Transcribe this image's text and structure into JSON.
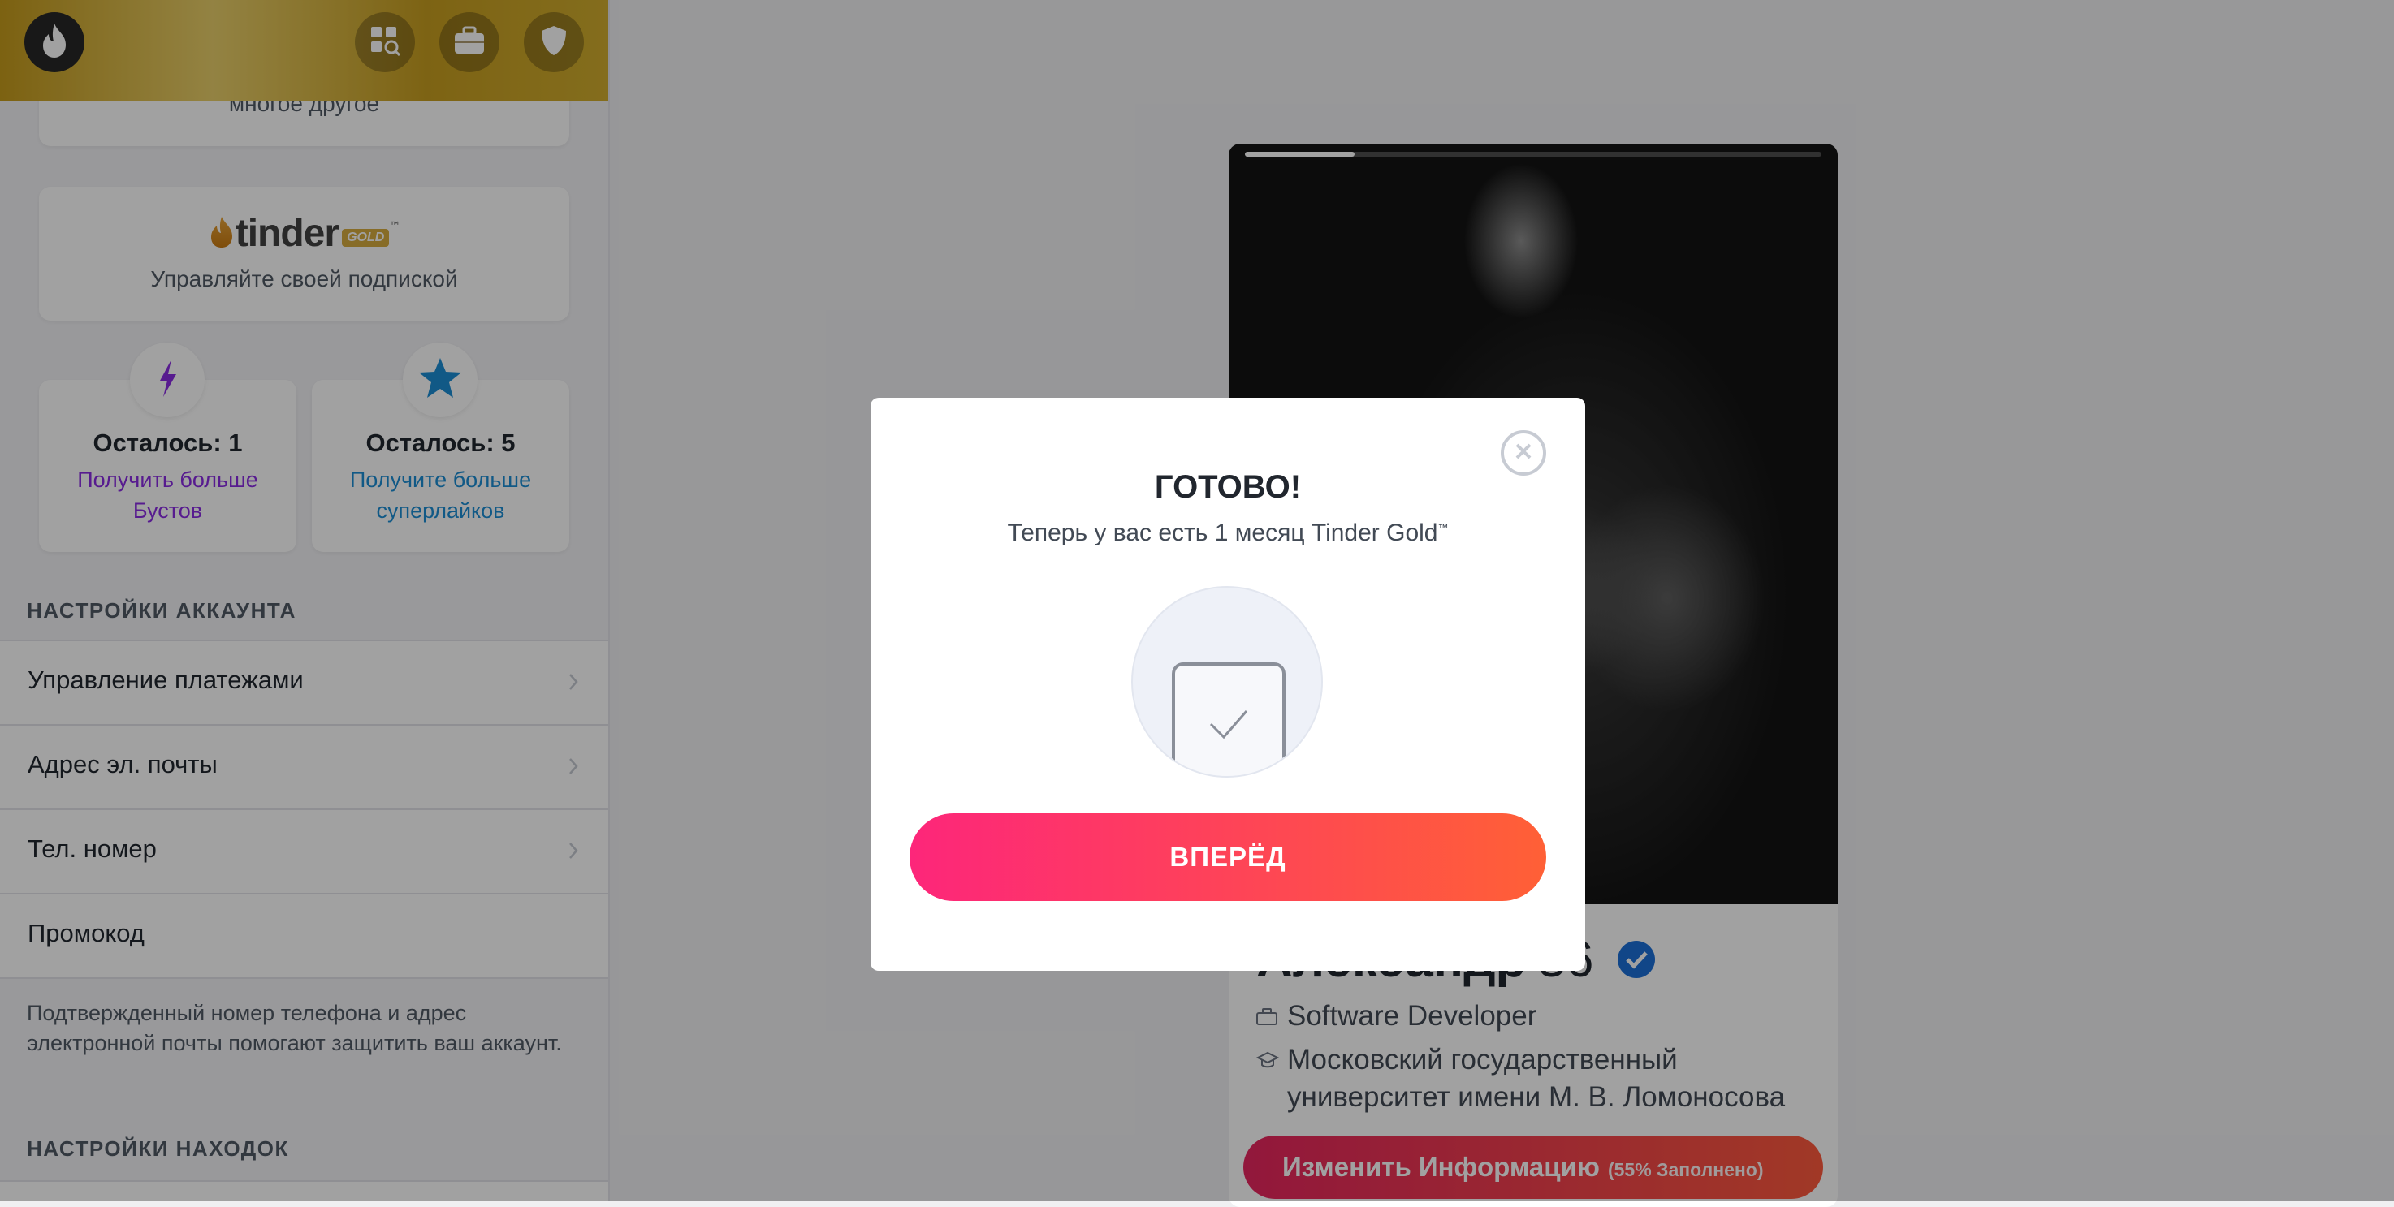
{
  "sidebar": {
    "top_card_text": "многое другое",
    "gold_card": {
      "logo_word": "tinder",
      "logo_badge": "GOLD",
      "logo_tm": "™",
      "manage_text": "Управляйте своей подпиской"
    },
    "boosts": {
      "remaining": "Осталось: 1",
      "get_more": "Получить больше Бустов",
      "color": "#8a2be2"
    },
    "super_likes": {
      "remaining": "Осталось: 5",
      "get_more": "Получите больше суперлайков",
      "color": "#1b8ed4"
    },
    "account_settings_title": "НАСТРОЙКИ АККАУНТА",
    "account_items": [
      {
        "label": "Управление платежами"
      },
      {
        "label": "Адрес эл. почты"
      },
      {
        "label": "Тел. номер"
      },
      {
        "label": "Промокод"
      }
    ],
    "security_note": "Подтвержденный номер телефона и адрес электронной почты помогают защитить ваш аккаунт.",
    "discovery_settings_title": "НАСТРОЙКИ НАХОДОК"
  },
  "topbar": {
    "icons": [
      "tinder-flame-icon",
      "explore-icon",
      "briefcase-icon",
      "shield-icon"
    ],
    "color": "#c99f22"
  },
  "profile": {
    "name": "Александр",
    "age": "36",
    "job": "Software Developer",
    "school": "Московский государственный университет имени М. В. Ломоносова",
    "photo_progress": 0.19
  },
  "edit_button": {
    "label": "Изменить Информацию",
    "completion": "(55% Заполнено)"
  },
  "modal": {
    "title": "ГОТОВО!",
    "subtitle": "Теперь у вас есть 1 месяц Tinder Gold",
    "subtitle_tm": "™",
    "cta": "ВПЕРЁД",
    "cta_colors": [
      "#fd267a",
      "#ff6036"
    ]
  }
}
